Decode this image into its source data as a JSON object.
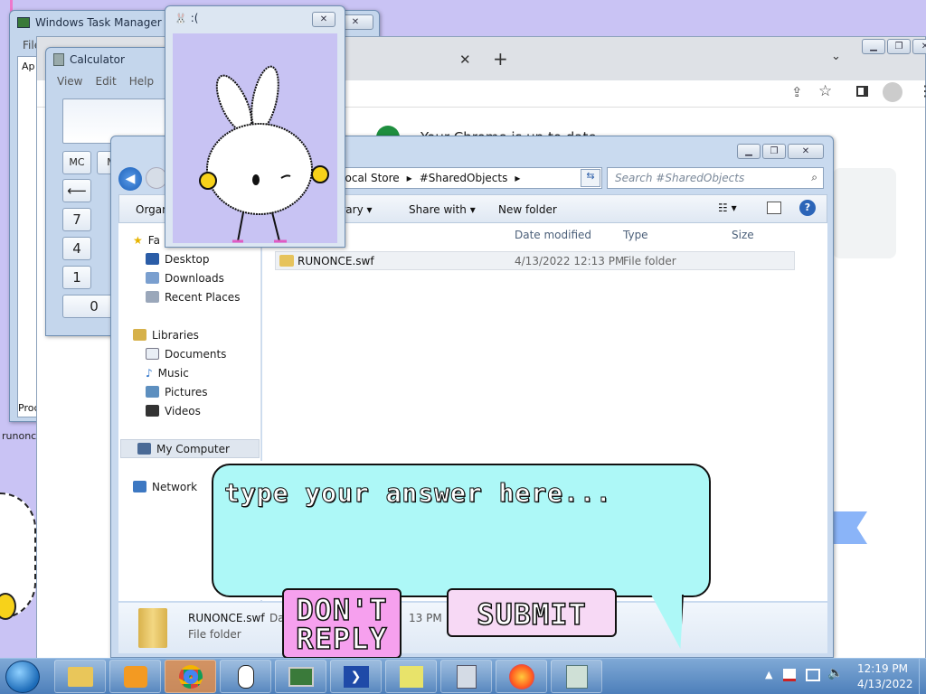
{
  "task_manager": {
    "title": "Windows Task Manager",
    "menu_file": "File",
    "tab_label": "Ap",
    "bottom_label": "Proc"
  },
  "calculator": {
    "title": "Calculator",
    "menu": [
      "View",
      "Edit",
      "Help"
    ],
    "buttons": {
      "mc": "MC",
      "m": "M",
      "back": "⟵",
      "seven": "7",
      "four": "4",
      "one": "1",
      "zero": "0"
    }
  },
  "bunny_window": {
    "title": ":("
  },
  "chrome": {
    "update_text": "Your Chrome is up to date"
  },
  "explorer": {
    "breadcrumb": [
      "Local Store",
      "#SharedObjects"
    ],
    "search_placeholder": "Search #SharedObjects",
    "toolbar": {
      "organize": "Organ",
      "library": "orary",
      "share_with": "Share with",
      "new_folder": "New folder"
    },
    "columns": {
      "date": "Date modified",
      "type": "Type",
      "size": "Size"
    },
    "sidebar": {
      "favorites": "Fa",
      "items": [
        "Desktop",
        "Downloads",
        "Recent Places"
      ],
      "libraries": "Libraries",
      "lib_items": [
        "Documents",
        "Music",
        "Pictures",
        "Videos"
      ],
      "computer": "My Computer",
      "network": "Network"
    },
    "files": [
      {
        "name": "RUNONCE.swf",
        "date": "4/13/2022 12:13 PM",
        "type": "File folder"
      }
    ],
    "details": {
      "name": "RUNONCE.swf",
      "type": "File folder",
      "date_prefix": "Da",
      "date_suffix": "13 PM"
    }
  },
  "desktop": {
    "icon_label": "runonc"
  },
  "dialog": {
    "placeholder": "type your answer here...",
    "dont_reply_line1": "DON'T",
    "dont_reply_line2": "REPLY",
    "submit": "SUBMIT"
  },
  "taskbar": {
    "time": "12:19 PM",
    "date": "4/13/2022"
  }
}
